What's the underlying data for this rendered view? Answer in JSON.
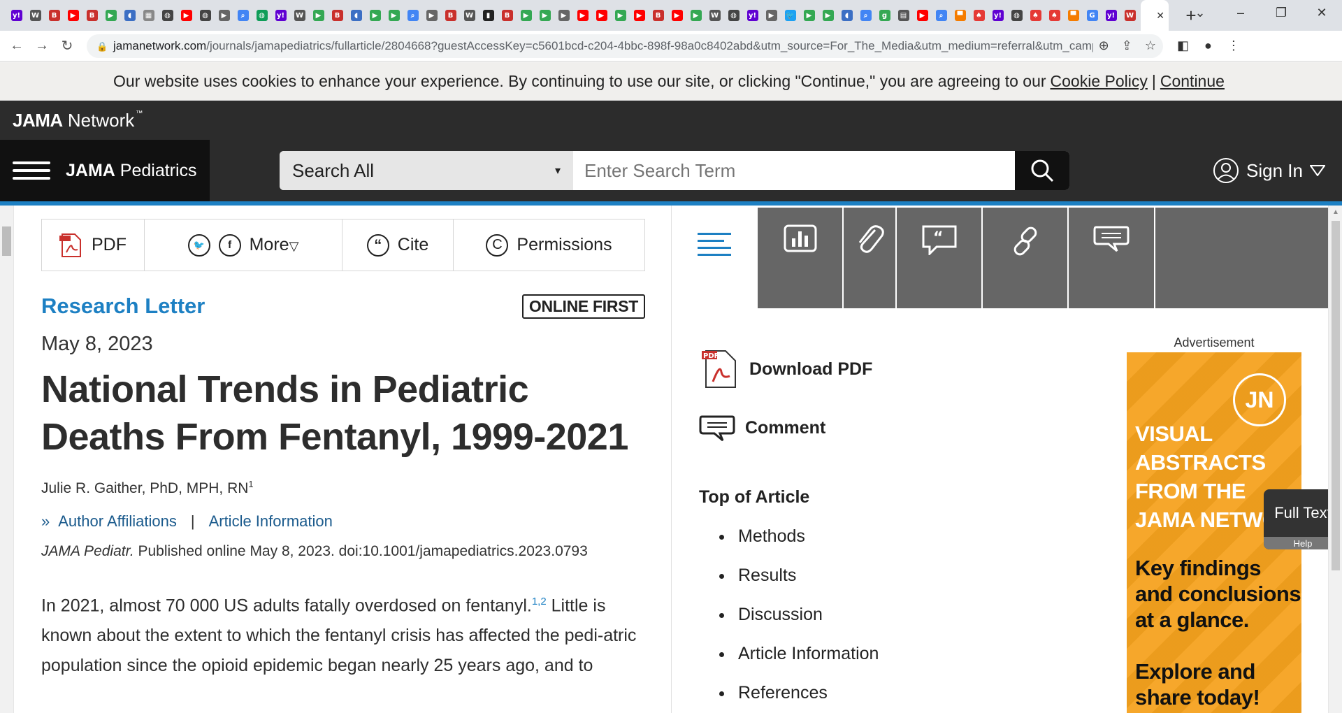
{
  "browser": {
    "tab_favicons": [
      {
        "icon": "yahoo-icon",
        "color": "#6001d2",
        "glyph": "y!"
      },
      {
        "icon": "wsj-icon",
        "color": "#555555",
        "glyph": "W"
      },
      {
        "icon": "b-icon",
        "color": "#c9302c",
        "glyph": "B"
      },
      {
        "icon": "youtube-icon",
        "color": "#ff0000",
        "glyph": "▶"
      },
      {
        "icon": "b-icon",
        "color": "#c9302c",
        "glyph": "B"
      },
      {
        "icon": "play-icon",
        "color": "#34a853",
        "glyph": "▶"
      },
      {
        "icon": "shield-icon",
        "color": "#3c6fc4",
        "glyph": "◖"
      },
      {
        "icon": "image-icon",
        "color": "#888888",
        "glyph": "▦"
      },
      {
        "icon": "globe-icon",
        "color": "#444444",
        "glyph": "◍"
      },
      {
        "icon": "youtube-icon",
        "color": "#ff0000",
        "glyph": "▶"
      },
      {
        "icon": "globe-icon",
        "color": "#444444",
        "glyph": "◍"
      },
      {
        "icon": "bookmark-icon",
        "color": "#666666",
        "glyph": "▶"
      },
      {
        "icon": "search-icon",
        "color": "#4285f4",
        "glyph": "⌕"
      },
      {
        "icon": "globe-icon",
        "color": "#0f9d58",
        "glyph": "◍"
      },
      {
        "icon": "yahoo-icon",
        "color": "#6001d2",
        "glyph": "y!"
      },
      {
        "icon": "wsj-icon",
        "color": "#555555",
        "glyph": "W"
      },
      {
        "icon": "play-icon",
        "color": "#34a853",
        "glyph": "▶"
      },
      {
        "icon": "b-icon",
        "color": "#c9302c",
        "glyph": "B"
      },
      {
        "icon": "shield-icon",
        "color": "#3c6fc4",
        "glyph": "◖"
      },
      {
        "icon": "play-icon",
        "color": "#34a853",
        "glyph": "▶"
      },
      {
        "icon": "play-icon",
        "color": "#34a853",
        "glyph": "▶"
      },
      {
        "icon": "search-icon",
        "color": "#4285f4",
        "glyph": "⌕"
      },
      {
        "icon": "bookmark-icon",
        "color": "#666666",
        "glyph": "▶"
      },
      {
        "icon": "b-icon",
        "color": "#c9302c",
        "glyph": "B"
      },
      {
        "icon": "wsj-icon",
        "color": "#555555",
        "glyph": "W"
      },
      {
        "icon": "bookmark-icon",
        "color": "#222222",
        "glyph": "▮"
      },
      {
        "icon": "b-icon",
        "color": "#c9302c",
        "glyph": "B"
      },
      {
        "icon": "play-icon",
        "color": "#34a853",
        "glyph": "▶"
      },
      {
        "icon": "play-icon",
        "color": "#34a853",
        "glyph": "▶"
      },
      {
        "icon": "bookmark-icon",
        "color": "#666666",
        "glyph": "▶"
      },
      {
        "icon": "youtube-icon",
        "color": "#ff0000",
        "glyph": "▶"
      },
      {
        "icon": "youtube-icon",
        "color": "#ff0000",
        "glyph": "▶"
      },
      {
        "icon": "play-icon",
        "color": "#34a853",
        "glyph": "▶"
      },
      {
        "icon": "youtube-icon",
        "color": "#ff0000",
        "glyph": "▶"
      },
      {
        "icon": "b-icon",
        "color": "#c9302c",
        "glyph": "B"
      },
      {
        "icon": "youtube-icon",
        "color": "#ff0000",
        "glyph": "▶"
      },
      {
        "icon": "play-icon",
        "color": "#34a853",
        "glyph": "▶"
      },
      {
        "icon": "wsj-icon",
        "color": "#555555",
        "glyph": "W"
      },
      {
        "icon": "globe-icon",
        "color": "#444444",
        "glyph": "◍"
      },
      {
        "icon": "yahoo-icon",
        "color": "#6001d2",
        "glyph": "y!"
      },
      {
        "icon": "bookmark-icon",
        "color": "#666666",
        "glyph": "▶"
      },
      {
        "icon": "twitter-icon",
        "color": "#1da1f2",
        "glyph": "🐦"
      },
      {
        "icon": "play-icon",
        "color": "#34a853",
        "glyph": "▶"
      },
      {
        "icon": "play-icon",
        "color": "#34a853",
        "glyph": "▶"
      },
      {
        "icon": "shield-icon",
        "color": "#3c6fc4",
        "glyph": "◖"
      },
      {
        "icon": "search-icon",
        "color": "#4285f4",
        "glyph": "⌕"
      },
      {
        "icon": "g-icon",
        "color": "#34a853",
        "glyph": "g"
      },
      {
        "icon": "news-icon",
        "color": "#555555",
        "glyph": "▤"
      },
      {
        "icon": "youtube-icon",
        "color": "#ff0000",
        "glyph": "▶"
      },
      {
        "icon": "search-icon",
        "color": "#4285f4",
        "glyph": "⌕"
      },
      {
        "icon": "bookmark-icon",
        "color": "#f57c00",
        "glyph": "▀"
      },
      {
        "icon": "tree-icon",
        "color": "#e53935",
        "glyph": "♠"
      },
      {
        "icon": "yahoo-icon",
        "color": "#6001d2",
        "glyph": "y!"
      },
      {
        "icon": "globe-icon",
        "color": "#444444",
        "glyph": "◍"
      },
      {
        "icon": "tree-icon",
        "color": "#e53935",
        "glyph": "♠"
      },
      {
        "icon": "tree-icon",
        "color": "#e53935",
        "glyph": "♠"
      },
      {
        "icon": "bookmark-icon",
        "color": "#f57c00",
        "glyph": "▀"
      },
      {
        "icon": "google-icon",
        "color": "#4285f4",
        "glyph": "G"
      },
      {
        "icon": "yahoo-icon",
        "color": "#6001d2",
        "glyph": "y!"
      },
      {
        "icon": "w-icon",
        "color": "#c9302c",
        "glyph": "W"
      }
    ],
    "active_tab_close": "✕",
    "new_tab": "+",
    "url_host": "jamanetwork.com",
    "url_path": "/journals/jamapediatrics/fullarticle/2804668?guestAccessKey=c5601bcd-c204-4bbc-898f-98a0c8402abd&utm_source=For_The_Media&utm_medium=referral&utm_campai..."
  },
  "cookie_banner": {
    "text": "Our website uses cookies to enhance your experience. By continuing to use our site, or clicking \"Continue,\" you are agreeing to our",
    "policy_link": "Cookie Policy",
    "separator": "|",
    "continue_link": "Continue"
  },
  "network": {
    "brand_bold": "JAMA",
    "brand_rest": " Network",
    "tm": "™"
  },
  "journal": {
    "brand_bold": "JAMA",
    "brand_rest": " Pediatrics"
  },
  "search": {
    "scope": "Search All",
    "scope_arrow": "▾",
    "placeholder": "Enter Search Term"
  },
  "signin": {
    "label": "Sign In"
  },
  "toolbar": {
    "pdf": "PDF",
    "more": "More",
    "cite": "Cite",
    "permissions": "Permissions"
  },
  "article": {
    "type": "Research Letter",
    "badge": "ONLINE FIRST",
    "date": "May 8, 2023",
    "title": "National Trends in Pediatric Deaths From Fentanyl, 1999-2021",
    "author": "Julie R. Gaither, PhD, MPH, RN",
    "author_sup": "1",
    "affiliations_link": "Author Affiliations",
    "link_sep": "|",
    "info_link": "Article Information",
    "journal_abbr": "JAMA Pediatr.",
    "citation": " Published online May 8, 2023. doi:10.1001/jamapediatrics.2023.0793",
    "body_1": "In 2021, almost 70 000 US adults fatally overdosed on fentanyl.",
    "body_sup": "1,2",
    "body_2": " Little is known about the extent to which the fentanyl crisis has affected the pedi-atric population since the opioid epidemic began nearly 25 years ago, and to"
  },
  "rail": {
    "download_pdf": "Download PDF",
    "comment": "Comment",
    "top_of_article": "Top of Article",
    "toc": [
      "Methods",
      "Results",
      "Discussion",
      "Article Information",
      "References"
    ]
  },
  "ad": {
    "label": "Advertisement",
    "logo": "JN",
    "headline": [
      "VISUAL",
      "ABSTRACTS",
      "FROM THE",
      "JAMA NETWO"
    ],
    "key": [
      "Key findings",
      "and conclusions",
      "at a glance."
    ],
    "explore": [
      "Explore and",
      "share today!"
    ]
  },
  "fulltext": {
    "label": "Full Text",
    "help": "Help"
  }
}
